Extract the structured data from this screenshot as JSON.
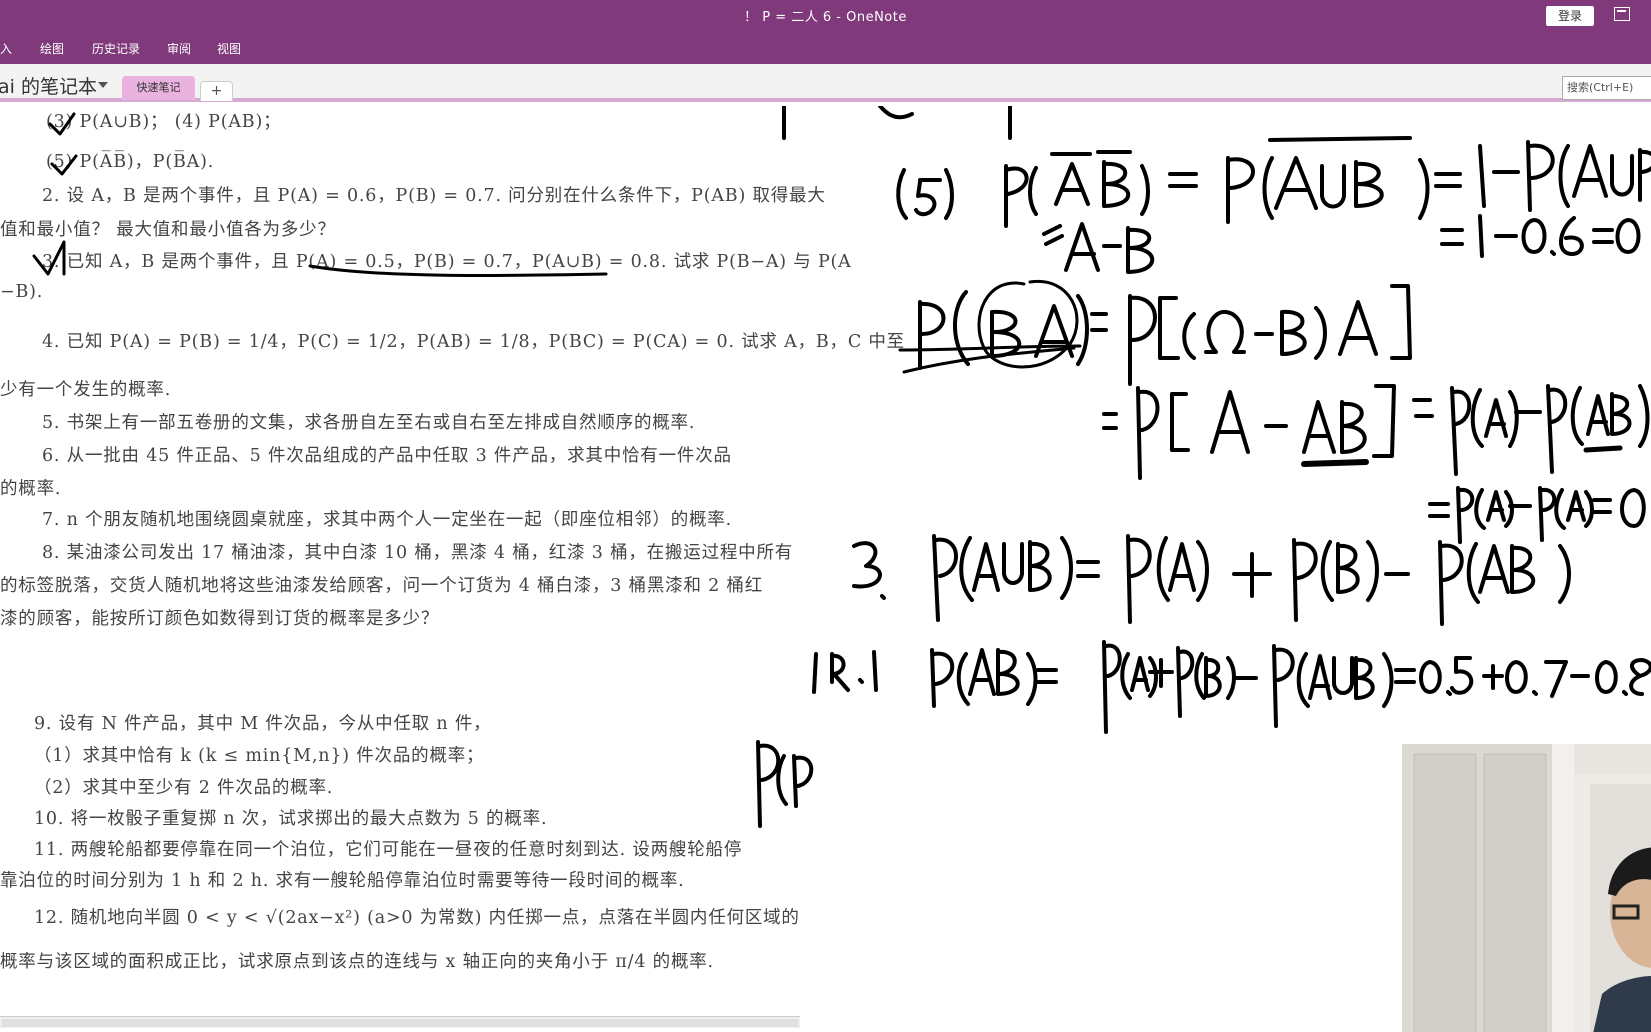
{
  "window": {
    "title": "！ P =   二人  6 - OneNote",
    "login_label": "登录"
  },
  "ribbon": {
    "tabs": [
      "入",
      "绘图",
      "历史记录",
      "审阅",
      "视图"
    ]
  },
  "notebook": {
    "name": "ai 的笔记本",
    "section_tab": "快速笔记",
    "add_tab_label": "+",
    "search_placeholder": "搜索(Ctrl+E)"
  },
  "textbook": {
    "lines": [
      "(3) P(A∪B)；                              (4) P(AB)；",
      "(5) P(A̅B̅)，P(B̅A).",
      "2. 设 A，B 是两个事件，且 P(A) = 0.6，P(B) = 0.7. 问分别在什么条件下，P(AB) 取得最大",
      "值和最小值？ 最大值和最小值各为多少？",
      "3. 已知 A，B 是两个事件，且 P(A) = 0.5，P(B) = 0.7，P(A∪B) = 0.8. 试求 P(B−A) 与 P(A",
      "−B).",
      "4. 已知 P(A) = P(B) = 1/4，P(C) = 1/2，P(AB) = 1/8，P(BC) = P(CA) = 0. 试求 A，B，C 中至",
      "少有一个发生的概率.",
      "5. 书架上有一部五卷册的文集，求各册自左至右或自右至左排成自然顺序的概率.",
      "6. 从一批由 45 件正品、5 件次品组成的产品中任取 3 件产品，求其中恰有一件次品",
      "的概率.",
      "7. n 个朋友随机地围绕圆桌就座，求其中两个人一定坐在一起（即座位相邻）的概率.",
      "8. 某油漆公司发出 17 桶油漆，其中白漆 10 桶，黑漆 4 桶，红漆 3 桶，在搬运过程中所有",
      "的标签脱落，交货人随机地将这些油漆发给顾客，问一个订货为 4 桶白漆，3 桶黑漆和 2 桶红",
      "漆的顾客，能按所订颜色如数得到订货的概率是多少？",
      "9. 设有 N 件产品，其中 M 件次品，今从中任取 n 件，",
      "（1）求其中恰有 k (k ≤ min{M,n}) 件次品的概率；",
      "（2）求其中至少有 2 件次品的概率.",
      "10. 将一枚骰子重复掷 n 次，试求掷出的最大点数为 5 的概率.",
      "11. 两艘轮船都要停靠在同一个泊位，它们可能在一昼夜的任意时刻到达. 设两艘轮船停",
      "靠泊位的时间分别为 1 h 和 2 h. 求有一艘轮船停靠泊位时需要等待一段时间的概率.",
      "12. 随机地向半圆 0 < y < √(2ax−x²) (a>0 为常数) 内任掷一点，点落在半圆内任何区域的",
      "概率与该区域的面积成正比，试求原点到该点的连线与 x 轴正向的夹角小于 π/4 的概率."
    ]
  },
  "colors": {
    "titlebar": "#80397b",
    "section_tab": "#e9b2df",
    "ink": "#000000"
  }
}
